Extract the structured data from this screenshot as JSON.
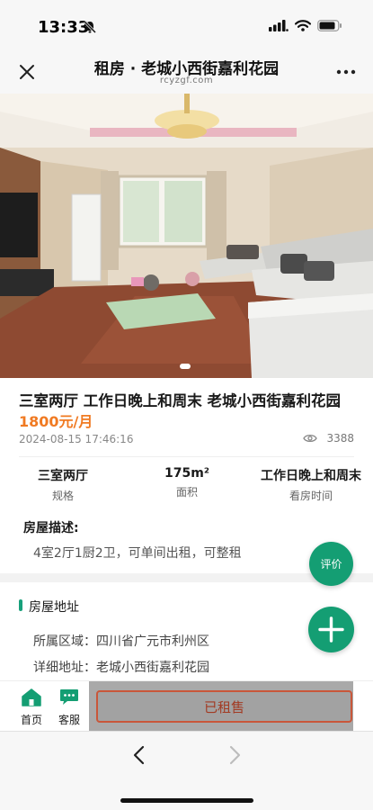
{
  "status_bar": {
    "time": "13:33"
  },
  "nav": {
    "title": "租房 · 老城小西街嘉利花园",
    "domain": "rcyzgf.com"
  },
  "listing": {
    "title": "三室两厅 工作日晚上和周末 老城小西街嘉利花园",
    "price": "1800元/月",
    "date": "2024-08-15 17:46:16",
    "views": "3388"
  },
  "specs": [
    {
      "value": "三室两厅",
      "label": "规格"
    },
    {
      "value": "175m²",
      "label": "面积"
    },
    {
      "value": "工作日晚上和周末",
      "label": "看房时间"
    }
  ],
  "description": {
    "heading": "房屋描述:",
    "text": "4室2厅1厨2卫，可单间出租，可整租"
  },
  "address": {
    "heading": "房屋地址",
    "region_label": "所属区域：",
    "region_value": "四川省广元市利州区",
    "detail_label": "详细地址：",
    "detail_value": "老城小西街嘉利花园"
  },
  "fab": {
    "review_label": "评价"
  },
  "bottom_bar": {
    "home_label": "首页",
    "service_label": "客服",
    "rented_label": "已租售"
  },
  "colors": {
    "accent_green": "#149e73",
    "price_orange": "#f07a22",
    "rented_border": "#c9573a"
  }
}
